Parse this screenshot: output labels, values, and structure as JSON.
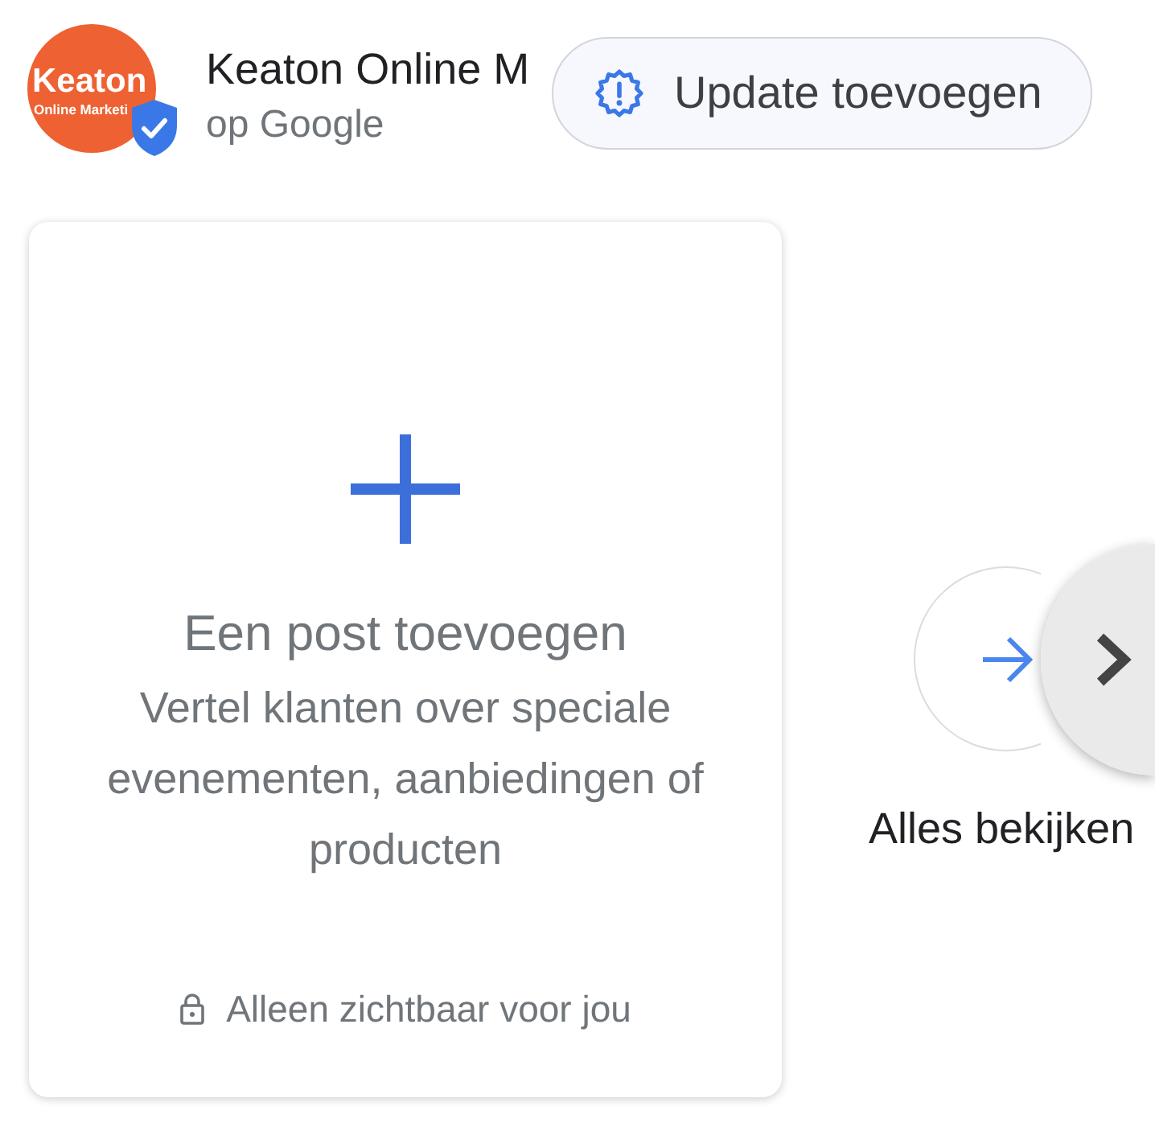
{
  "business": {
    "logo": {
      "line_1": "Keaton",
      "line_2": "Online Marketi"
    },
    "verified": true,
    "name": "Keaton Online M",
    "source": "op Google"
  },
  "update_button": {
    "label": "Update toevoegen"
  },
  "post_card": {
    "title": "Een post toevoegen",
    "description": "Vertel klanten over speciale evenementen, aanbiedingen of producten",
    "visibility": "Alleen zichtbaar voor jou"
  },
  "view_all": {
    "label": "Alles bekijken"
  }
}
